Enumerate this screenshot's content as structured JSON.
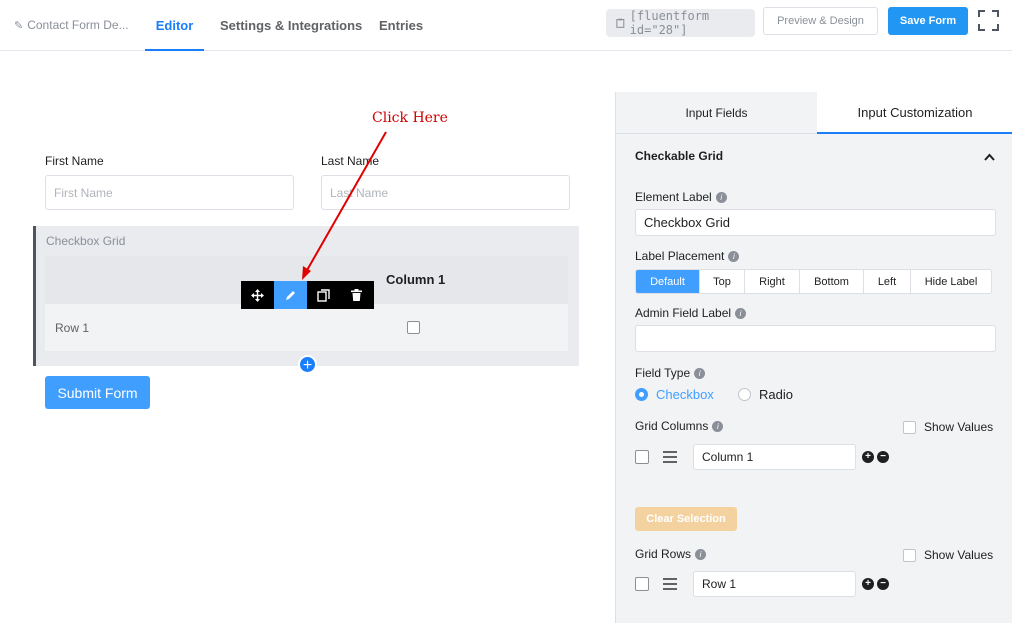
{
  "header": {
    "breadcrumb": "Contact Form De...",
    "tabs": [
      "Editor",
      "Settings & Integrations",
      "Entries"
    ],
    "active_tab": "Editor",
    "shortcode": "[fluentform id=\"28\"]",
    "preview_label": "Preview & Design",
    "save_label": "Save Form"
  },
  "form": {
    "first_name_label": "First Name",
    "first_name_placeholder": "First Name",
    "last_name_label": "Last Name",
    "last_name_placeholder": "Last Name",
    "grid_label": "Checkbox Grid",
    "grid_column": "Column 1",
    "grid_row": "Row 1",
    "submit_label": "Submit Form",
    "annotation": "Click Here"
  },
  "panel": {
    "tabs": [
      "Input Fields",
      "Input Customization"
    ],
    "active_tab": "Input Customization",
    "section_title": "Checkable Grid",
    "element_label_title": "Element Label",
    "element_label_value": "Checkbox Grid",
    "label_placement_title": "Label Placement",
    "placements": [
      "Default",
      "Top",
      "Right",
      "Bottom",
      "Left",
      "Hide Label"
    ],
    "placement_selected": "Default",
    "admin_label_title": "Admin Field Label",
    "admin_label_value": "",
    "field_type_title": "Field Type",
    "field_types": [
      "Checkbox",
      "Radio"
    ],
    "field_type_selected": "Checkbox",
    "grid_columns_title": "Grid Columns",
    "show_values": "Show Values",
    "column_value": "Column 1",
    "clear_label": "Clear Selection",
    "grid_rows_title": "Grid Rows",
    "row_value": "Row 1"
  },
  "colors": {
    "primary": "#409eff",
    "accent": "#1a7efb",
    "annotation": "#d00000",
    "clear_button": "#f3d2a0"
  }
}
